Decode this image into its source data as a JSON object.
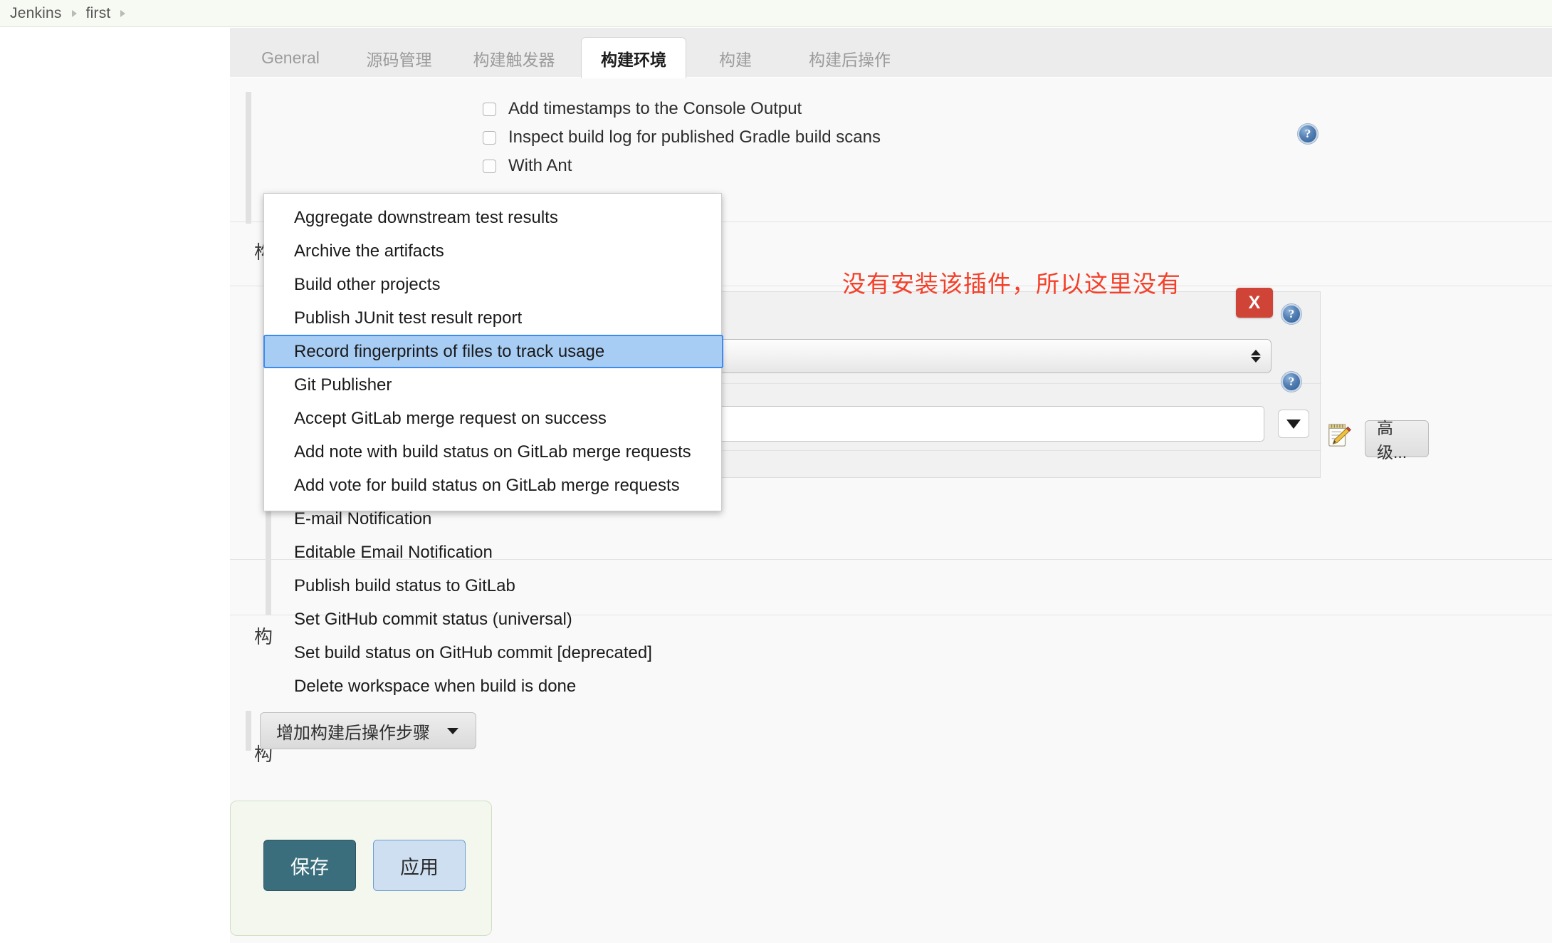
{
  "breadcrumb": {
    "items": [
      "Jenkins",
      "first"
    ],
    "separator_icon": "triangle-right-icon"
  },
  "tabs": [
    {
      "label": "General",
      "active": false
    },
    {
      "label": "源码管理",
      "active": false
    },
    {
      "label": "构建触发器",
      "active": false
    },
    {
      "label": "构建环境",
      "active": true
    },
    {
      "label": "构建",
      "active": false
    },
    {
      "label": "构建后操作",
      "active": false
    }
  ],
  "build_environment": {
    "checkboxes": [
      {
        "label": "Add timestamps to the Console Output",
        "checked": false
      },
      {
        "label": "Inspect build log for published Gradle build scans",
        "checked": false
      },
      {
        "label": "With Ant",
        "checked": false
      }
    ]
  },
  "annotation": {
    "text": "没有安装该插件，所以这里没有",
    "color": "#f4402a"
  },
  "publisher_dropdown": {
    "items": [
      "Aggregate downstream test results",
      "Archive the artifacts",
      "Build other projects",
      "Publish JUnit test result report",
      "Record fingerprints of files to track usage",
      "Git Publisher",
      "Accept GitLab merge request on success",
      "Add note with build status on GitLab merge requests",
      "Add vote for build status on GitLab merge requests",
      "E-mail Notification",
      "Editable Email Notification",
      "Publish build status to GitLab",
      "Set GitHub commit status (universal)",
      "Set build status on GitHub commit [deprecated]",
      "Delete workspace when build is done"
    ],
    "selected_index": 4,
    "selected_color": "#a8cdf4",
    "selected_border_color": "#3d8bf0"
  },
  "form": {
    "delete_button_label": "X",
    "delete_button_color": "#cf4436",
    "help_icon_label": "?",
    "advanced_button_label": "高级...",
    "notepad_icon": "notepad-pencil-icon",
    "select_value": "",
    "text_value": "",
    "combo_toggle_icon": "triangle-down-icon"
  },
  "add_post_build_step": {
    "label": "增加构建后操作步骤",
    "caret_icon": "caret-down-icon"
  },
  "save_bar": {
    "save_label": "保存",
    "apply_label": "应用",
    "save_color": "#3b6e7d",
    "apply_color": "#cfdff2"
  },
  "ghost_chars": [
    "构",
    "构",
    "构"
  ]
}
